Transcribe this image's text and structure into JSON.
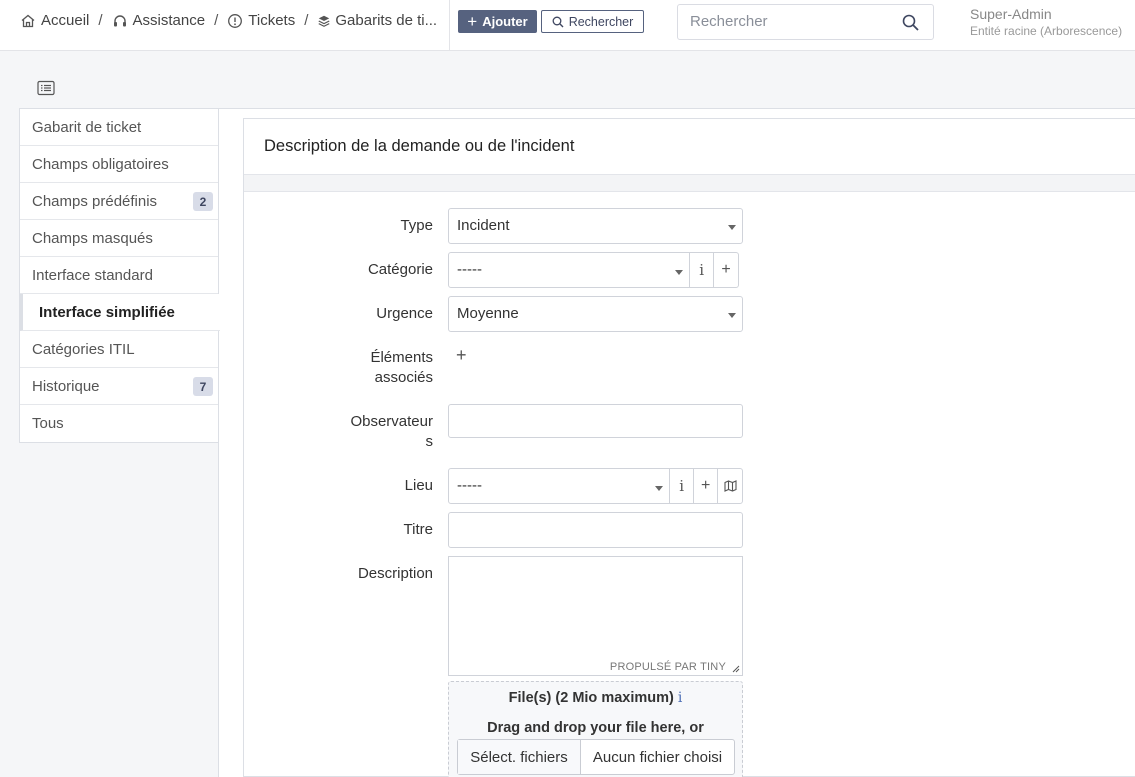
{
  "breadcrumb": {
    "home": "Accueil",
    "assistance": "Assistance",
    "tickets": "Tickets",
    "templates": "Gabarits de ti..."
  },
  "header": {
    "add_label": "Ajouter",
    "search_label": "Rechercher",
    "search_placeholder": "Rechercher",
    "user_name": "Super-Admin",
    "user_entity": "Entité racine (Arborescence)"
  },
  "sidebar": {
    "items": [
      {
        "label": "Gabarit de ticket",
        "badge": ""
      },
      {
        "label": "Champs obligatoires",
        "badge": ""
      },
      {
        "label": "Champs prédéfinis",
        "badge": "2"
      },
      {
        "label": "Champs masqués",
        "badge": ""
      },
      {
        "label": "Interface standard",
        "badge": ""
      },
      {
        "label": "Interface simplifiée",
        "badge": ""
      },
      {
        "label": "Catégories ITIL",
        "badge": ""
      },
      {
        "label": "Historique",
        "badge": "7"
      },
      {
        "label": "Tous",
        "badge": ""
      }
    ],
    "active_index": 5
  },
  "form": {
    "title": "Description de la demande ou de l'incident",
    "type_label": "Type",
    "type_value": "Incident",
    "category_label": "Catégorie",
    "category_value": "-----",
    "urgency_label": "Urgence",
    "urgency_value": "Moyenne",
    "items_label_1": "Éléments",
    "items_label_2": "associés",
    "observers_label_1": "Observateur",
    "observers_label_2": "s",
    "location_label": "Lieu",
    "location_value": "-----",
    "title_label": "Titre",
    "description_label": "Description",
    "powered_by": "PROPULSÉ PAR TINY",
    "files_title": "File(s) (2 Mio maximum)",
    "files_drag": "Drag and drop your file here, or",
    "files_button": "Sélect. fichiers",
    "files_none": "Aucun fichier choisi"
  },
  "icons": {
    "home": "home-icon",
    "headset": "headset-icon",
    "ticket": "alert-circle-icon",
    "stack": "layers-icon",
    "search": "search-icon",
    "list": "list-icon",
    "info": "info-icon",
    "plus": "plus-icon",
    "map": "map-icon"
  }
}
